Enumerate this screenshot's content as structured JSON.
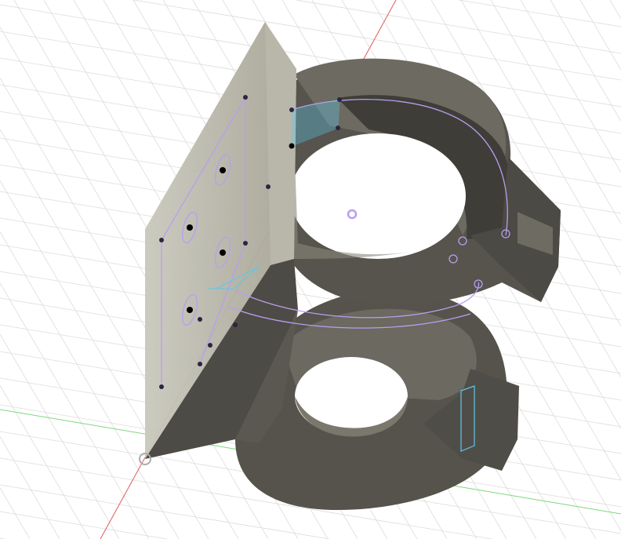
{
  "viewport": {
    "background": "#ffffff",
    "grid_color": "#dcdcdc",
    "x_axis_color": "#e05a5a",
    "y_axis_color": "#7fd67f",
    "body_color": "#5e5b53",
    "plate_color": "#a9a797",
    "sketch_color": "#b89ef0",
    "constraint_color": "#5ec8e8"
  }
}
